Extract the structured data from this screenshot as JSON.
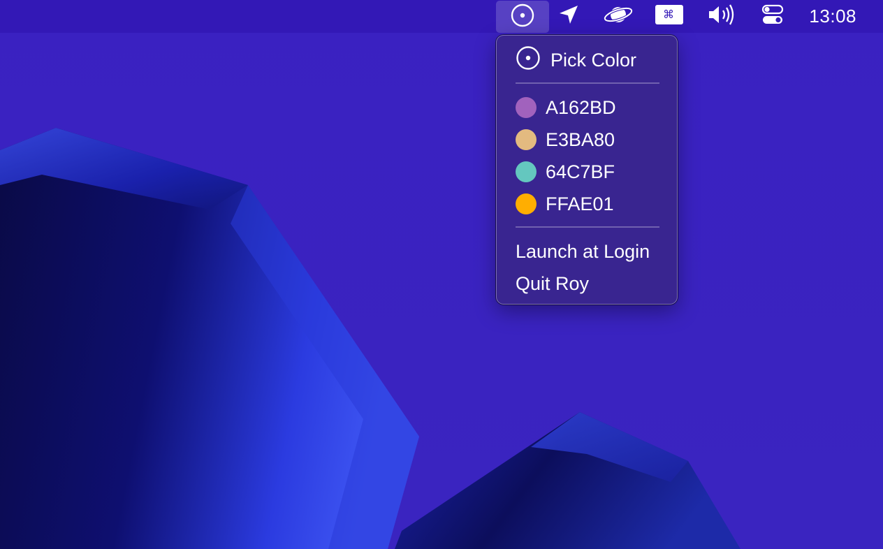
{
  "menubar": {
    "items": [
      {
        "icon": "eyedropper-target-icon"
      },
      {
        "icon": "location-arrow-icon"
      },
      {
        "icon": "planet-icon"
      },
      {
        "icon": "keyboard-command-icon",
        "glyph": "⌘"
      },
      {
        "icon": "speaker-volume-icon"
      },
      {
        "icon": "control-center-toggle-icon"
      }
    ],
    "clock": "13:08"
  },
  "dropdown": {
    "pick_color": "Pick Color",
    "colors": [
      {
        "hex": "A162BD",
        "swatch": "#A162BD"
      },
      {
        "hex": "E3BA80",
        "swatch": "#E3BA80"
      },
      {
        "hex": "64C7BF",
        "swatch": "#64C7BF"
      },
      {
        "hex": "FFAE01",
        "swatch": "#FFAE01"
      }
    ],
    "launch_at_login": "Launch at Login",
    "quit": "Quit Roy"
  },
  "colors": {
    "desktop_background": "#3a22c0",
    "menubar_background": "#3318b6"
  }
}
